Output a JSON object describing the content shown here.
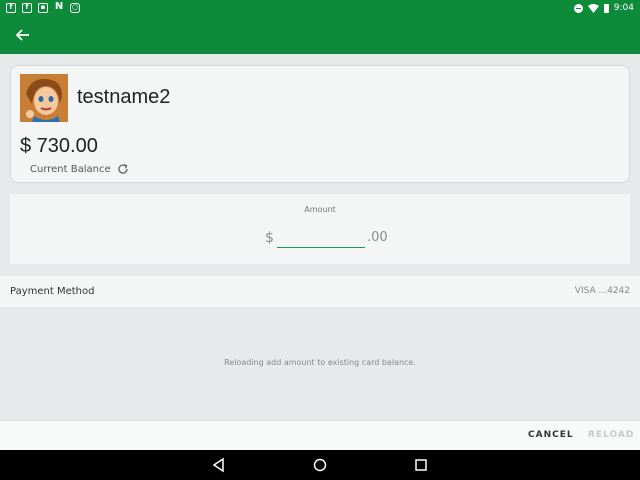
{
  "status_bar": {
    "time": "9:04",
    "notification_icons": [
      "facebook-icon",
      "facebook-icon",
      "gallery-icon",
      "n-app-icon",
      "instagram-icon"
    ]
  },
  "app_bar": {
    "back_icon": "arrow-left-icon"
  },
  "account": {
    "username": "testname2",
    "balance": "$ 730.00",
    "balance_label": "Current Balance",
    "refresh_icon": "refresh-icon"
  },
  "amount": {
    "label": "Amount",
    "currency": "$",
    "cents": ".00",
    "value": "",
    "placeholder": ""
  },
  "payment": {
    "label": "Payment Method",
    "value": "VISA ...4242"
  },
  "info": {
    "text": "Reloading add amount to existing card balance."
  },
  "actions": {
    "cancel": "CANCEL",
    "reload": "RELOAD"
  },
  "colors": {
    "primary": "#0d8a3a",
    "accent": "#1a9a48",
    "disabled": "#c6caca"
  }
}
